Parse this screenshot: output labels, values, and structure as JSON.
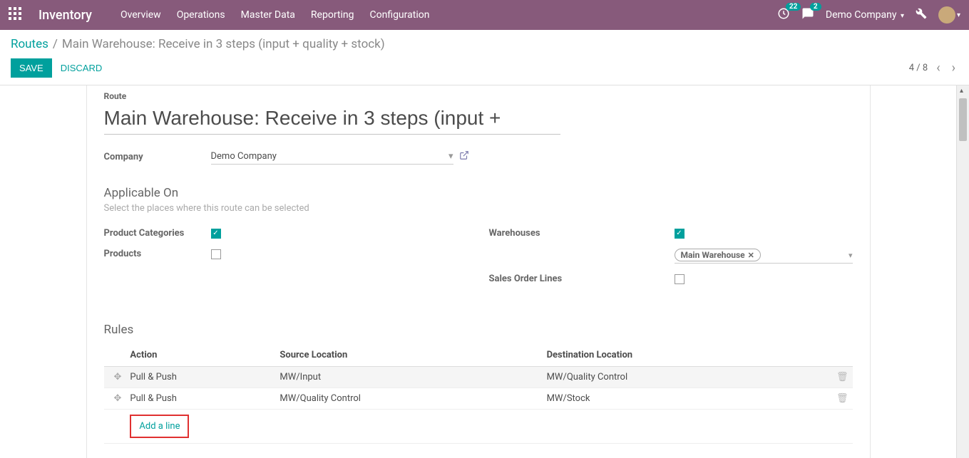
{
  "topbar": {
    "brand": "Inventory",
    "menu": [
      "Overview",
      "Operations",
      "Master Data",
      "Reporting",
      "Configuration"
    ],
    "notif1_count": "22",
    "notif2_count": "2",
    "company": "Demo Company"
  },
  "breadcrumb": {
    "root": "Routes",
    "sep": "/",
    "current": "Main Warehouse: Receive in 3 steps (input + quality + stock)"
  },
  "actions": {
    "save": "SAVE",
    "discard": "DISCARD",
    "pager": "4 / 8"
  },
  "form": {
    "route_label": "Route",
    "route_name": "Main Warehouse: Receive in 3 steps (input +",
    "company_label": "Company",
    "company_value": "Demo Company",
    "applicable_title": "Applicable On",
    "applicable_desc": "Select the places where this route can be selected",
    "product_categories_label": "Product Categories",
    "products_label": "Products",
    "warehouses_label": "Warehouses",
    "warehouse_tag": "Main Warehouse",
    "sales_order_lines_label": "Sales Order Lines",
    "rules_title": "Rules",
    "rules_headers": {
      "action": "Action",
      "source": "Source Location",
      "dest": "Destination Location"
    },
    "rules": [
      {
        "action": "Pull & Push",
        "source": "MW/Input",
        "dest": "MW/Quality Control"
      },
      {
        "action": "Pull & Push",
        "source": "MW/Quality Control",
        "dest": "MW/Stock"
      }
    ],
    "add_line": "Add a line"
  }
}
